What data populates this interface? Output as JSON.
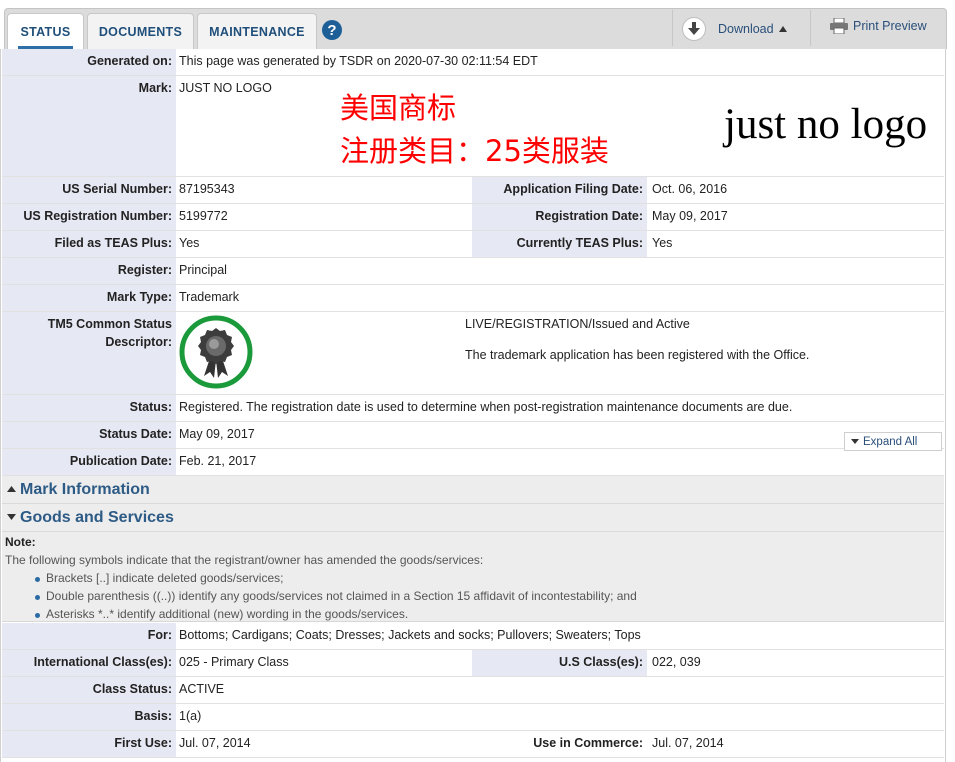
{
  "tabs": [
    {
      "label": "STATUS",
      "active": true
    },
    {
      "label": "DOCUMENTS",
      "active": false
    },
    {
      "label": "MAINTENANCE",
      "active": false
    }
  ],
  "toolbar": {
    "help": "?",
    "download": "Download",
    "print_preview": "Print Preview"
  },
  "generated": {
    "label": "Generated on:",
    "value": "This page was generated by TSDR on 2020-07-30 02:11:54 EDT"
  },
  "mark": {
    "label": "Mark:",
    "value": "JUST NO LOGO",
    "overlay_line1": "美国商标",
    "overlay_line2": "注册类目：25类服装",
    "image_text": "just no logo"
  },
  "serial": {
    "label": "US Serial Number:",
    "value": "87195343"
  },
  "filing_date": {
    "label": "Application Filing Date:",
    "value": "Oct. 06, 2016"
  },
  "reg_number": {
    "label": "US Registration Number:",
    "value": "5199772"
  },
  "reg_date": {
    "label": "Registration Date:",
    "value": "May 09, 2017"
  },
  "teas_filed": {
    "label": "Filed as TEAS Plus:",
    "value": "Yes"
  },
  "teas_current": {
    "label": "Currently TEAS Plus:",
    "value": "Yes"
  },
  "register": {
    "label": "Register:",
    "value": "Principal"
  },
  "mark_type": {
    "label": "Mark Type:",
    "value": "Trademark"
  },
  "tm5": {
    "label1": "TM5 Common Status",
    "label2": "Descriptor:",
    "status_line": "LIVE/REGISTRATION/Issued and Active",
    "description": "The trademark application has been registered with the Office.",
    "badge_color": "#1a9a3a"
  },
  "status": {
    "label": "Status:",
    "value": "Registered. The registration date is used to determine when post-registration maintenance documents are due."
  },
  "status_date": {
    "label": "Status Date:",
    "value": "May 09, 2017"
  },
  "pub_date": {
    "label": "Publication Date:",
    "value": "Feb. 21, 2017"
  },
  "sections": {
    "mark_info": "Mark Information",
    "goods": "Goods and Services",
    "expand_all": "Expand All"
  },
  "note": {
    "title": "Note:",
    "intro": "The following symbols indicate that the registrant/owner has amended the goods/services:",
    "items": [
      "Brackets [..] indicate deleted goods/services;",
      "Double parenthesis ((..)) identify any goods/services not claimed in a Section 15 affidavit of incontestability; and",
      "Asterisks *..* identify additional (new) wording in the goods/services."
    ]
  },
  "goods": {
    "for": {
      "label": "For:",
      "value": "Bottoms; Cardigans; Coats; Dresses; Jackets and socks; Pullovers; Sweaters; Tops"
    },
    "intl_class": {
      "label": "International Class(es):",
      "value": "025 - Primary Class"
    },
    "us_class": {
      "label": "U.S Class(es):",
      "value": "022, 039"
    },
    "class_status": {
      "label": "Class Status:",
      "value": "ACTIVE"
    },
    "basis": {
      "label": "Basis:",
      "value": "1(a)"
    },
    "first_use": {
      "label": "First Use:",
      "value": "Jul. 07, 2014"
    },
    "use_commerce": {
      "label": "Use in Commerce:",
      "value": "Jul. 07, 2014"
    }
  },
  "colors": {
    "label_bg": "#e6e8f3",
    "link": "#2d5b86",
    "overlay_red": "#ff0000"
  }
}
